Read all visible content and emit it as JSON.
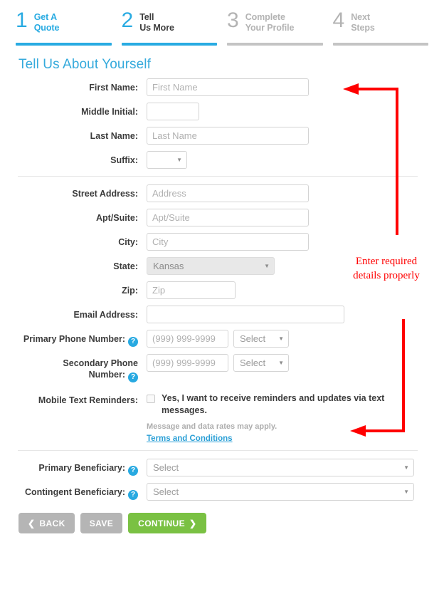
{
  "progress": {
    "steps": [
      {
        "num": "1",
        "label_line1": "Get A",
        "label_line2": "Quote",
        "state": "active"
      },
      {
        "num": "2",
        "label_line1": "Tell",
        "label_line2": "Us More",
        "state": "current"
      },
      {
        "num": "3",
        "label_line1": "Complete",
        "label_line2": "Your Profile",
        "state": "todo"
      },
      {
        "num": "4",
        "label_line1": "Next",
        "label_line2": "Steps",
        "state": "todo"
      }
    ]
  },
  "heading": "Tell Us About Yourself",
  "fields": {
    "first_name": {
      "label": "First Name:",
      "placeholder": "First Name",
      "value": ""
    },
    "middle_initial": {
      "label": "Middle Initial:",
      "placeholder": "",
      "value": ""
    },
    "last_name": {
      "label": "Last Name:",
      "placeholder": "Last Name",
      "value": ""
    },
    "suffix": {
      "label": "Suffix:",
      "selected": ""
    },
    "street_address": {
      "label": "Street Address:",
      "placeholder": "Address",
      "value": ""
    },
    "apt_suite": {
      "label": "Apt/Suite:",
      "placeholder": "Apt/Suite",
      "value": ""
    },
    "city": {
      "label": "City:",
      "placeholder": "City",
      "value": ""
    },
    "state": {
      "label": "State:",
      "selected": "Kansas"
    },
    "zip": {
      "label": "Zip:",
      "placeholder": "Zip",
      "value": ""
    },
    "email": {
      "label": "Email Address:",
      "placeholder": "",
      "value": ""
    },
    "primary_phone": {
      "label": "Primary Phone Number:",
      "placeholder": "(999) 999-9999",
      "value": "",
      "type_selected": "Select"
    },
    "secondary_phone": {
      "label_line1": "Secondary Phone",
      "label_line2": "Number:",
      "placeholder": "(999) 999-9999",
      "value": "",
      "type_selected": "Select"
    },
    "mobile_text": {
      "label": "Mobile Text Reminders:",
      "checkbox_text": "Yes, I want to receive reminders and updates via text messages.",
      "checked": false,
      "note": "Message and data rates may apply.",
      "terms_link": "Terms and Conditions"
    },
    "primary_beneficiary": {
      "label": "Primary Beneficiary:",
      "selected": "Select"
    },
    "contingent_beneficiary": {
      "label": "Contingent Beneficiary:",
      "selected": "Select"
    }
  },
  "help_icon_glyph": "?",
  "caret_glyph": "▼",
  "buttons": {
    "back": {
      "label": "BACK",
      "icon": "❮"
    },
    "save": {
      "label": "SAVE"
    },
    "continue": {
      "label": "CONTINUE",
      "icon": "❯"
    }
  },
  "annotation": {
    "text_line1": "Enter required",
    "text_line2": "details properly",
    "color": "#ff0000"
  },
  "colors": {
    "accent_blue": "#29abe2",
    "heading_blue": "#35aadc",
    "continue_green": "#7ac143",
    "button_grey": "#b5b5b5",
    "annotation_red": "#ff0000"
  }
}
